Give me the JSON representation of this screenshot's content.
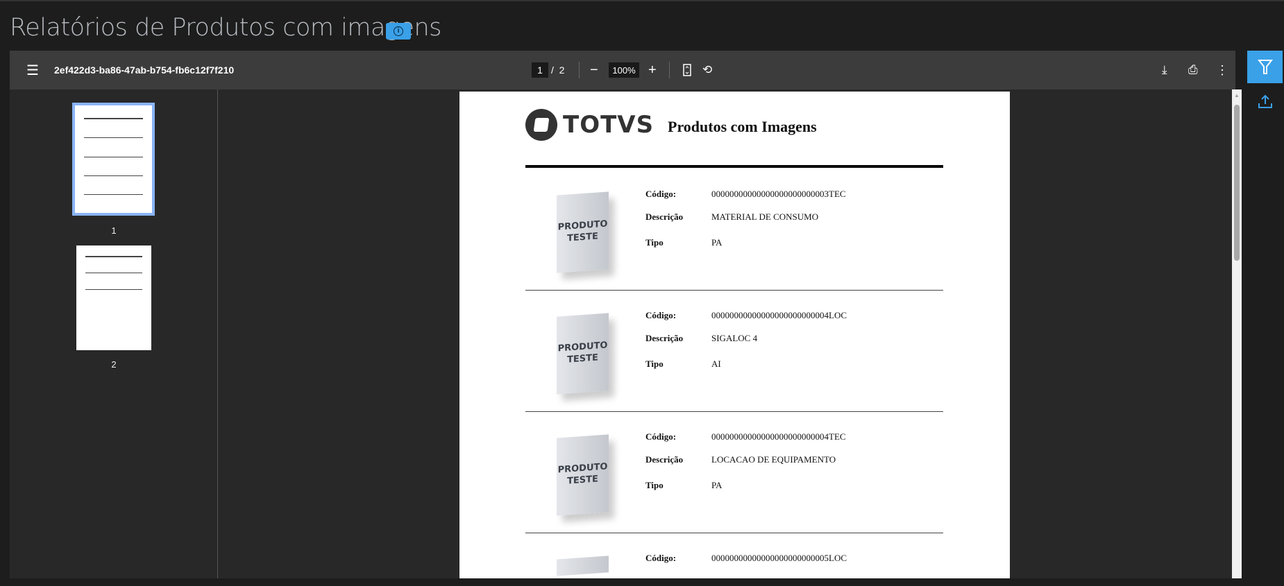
{
  "title": "Relatórios de Produtos com imagens",
  "info_icon": "info-icon",
  "viewer": {
    "document_name": "2ef422d3-ba86-47ab-b754-fb6c12f7f210",
    "current_page": "1",
    "page_separator": "/",
    "total_pages": "2",
    "zoom": "100%",
    "thumbnails": [
      {
        "label": "1"
      },
      {
        "label": "2"
      }
    ]
  },
  "report": {
    "logo_text": "TOTVS",
    "title": "Produtos com Imagens",
    "image_text_1": "PRODUTO",
    "image_text_2": "TESTE",
    "labels": {
      "code": "Código:",
      "description": "Descrição",
      "type": "Tipo"
    },
    "items": [
      {
        "code": "00000000000000000000000003TEC",
        "description": "MATERIAL DE CONSUMO",
        "type": "PA"
      },
      {
        "code": "00000000000000000000000004LOC",
        "description": "SIGALOC 4",
        "type": "AI"
      },
      {
        "code": "00000000000000000000000004TEC",
        "description": "LOCACAO DE EQUIPAMENTO",
        "type": "PA"
      },
      {
        "code": "00000000000000000000000005LOC"
      }
    ]
  },
  "colors": {
    "accent": "#3aa0e8",
    "background": "#1d1d1d",
    "toolbar": "#3c3c3c"
  }
}
